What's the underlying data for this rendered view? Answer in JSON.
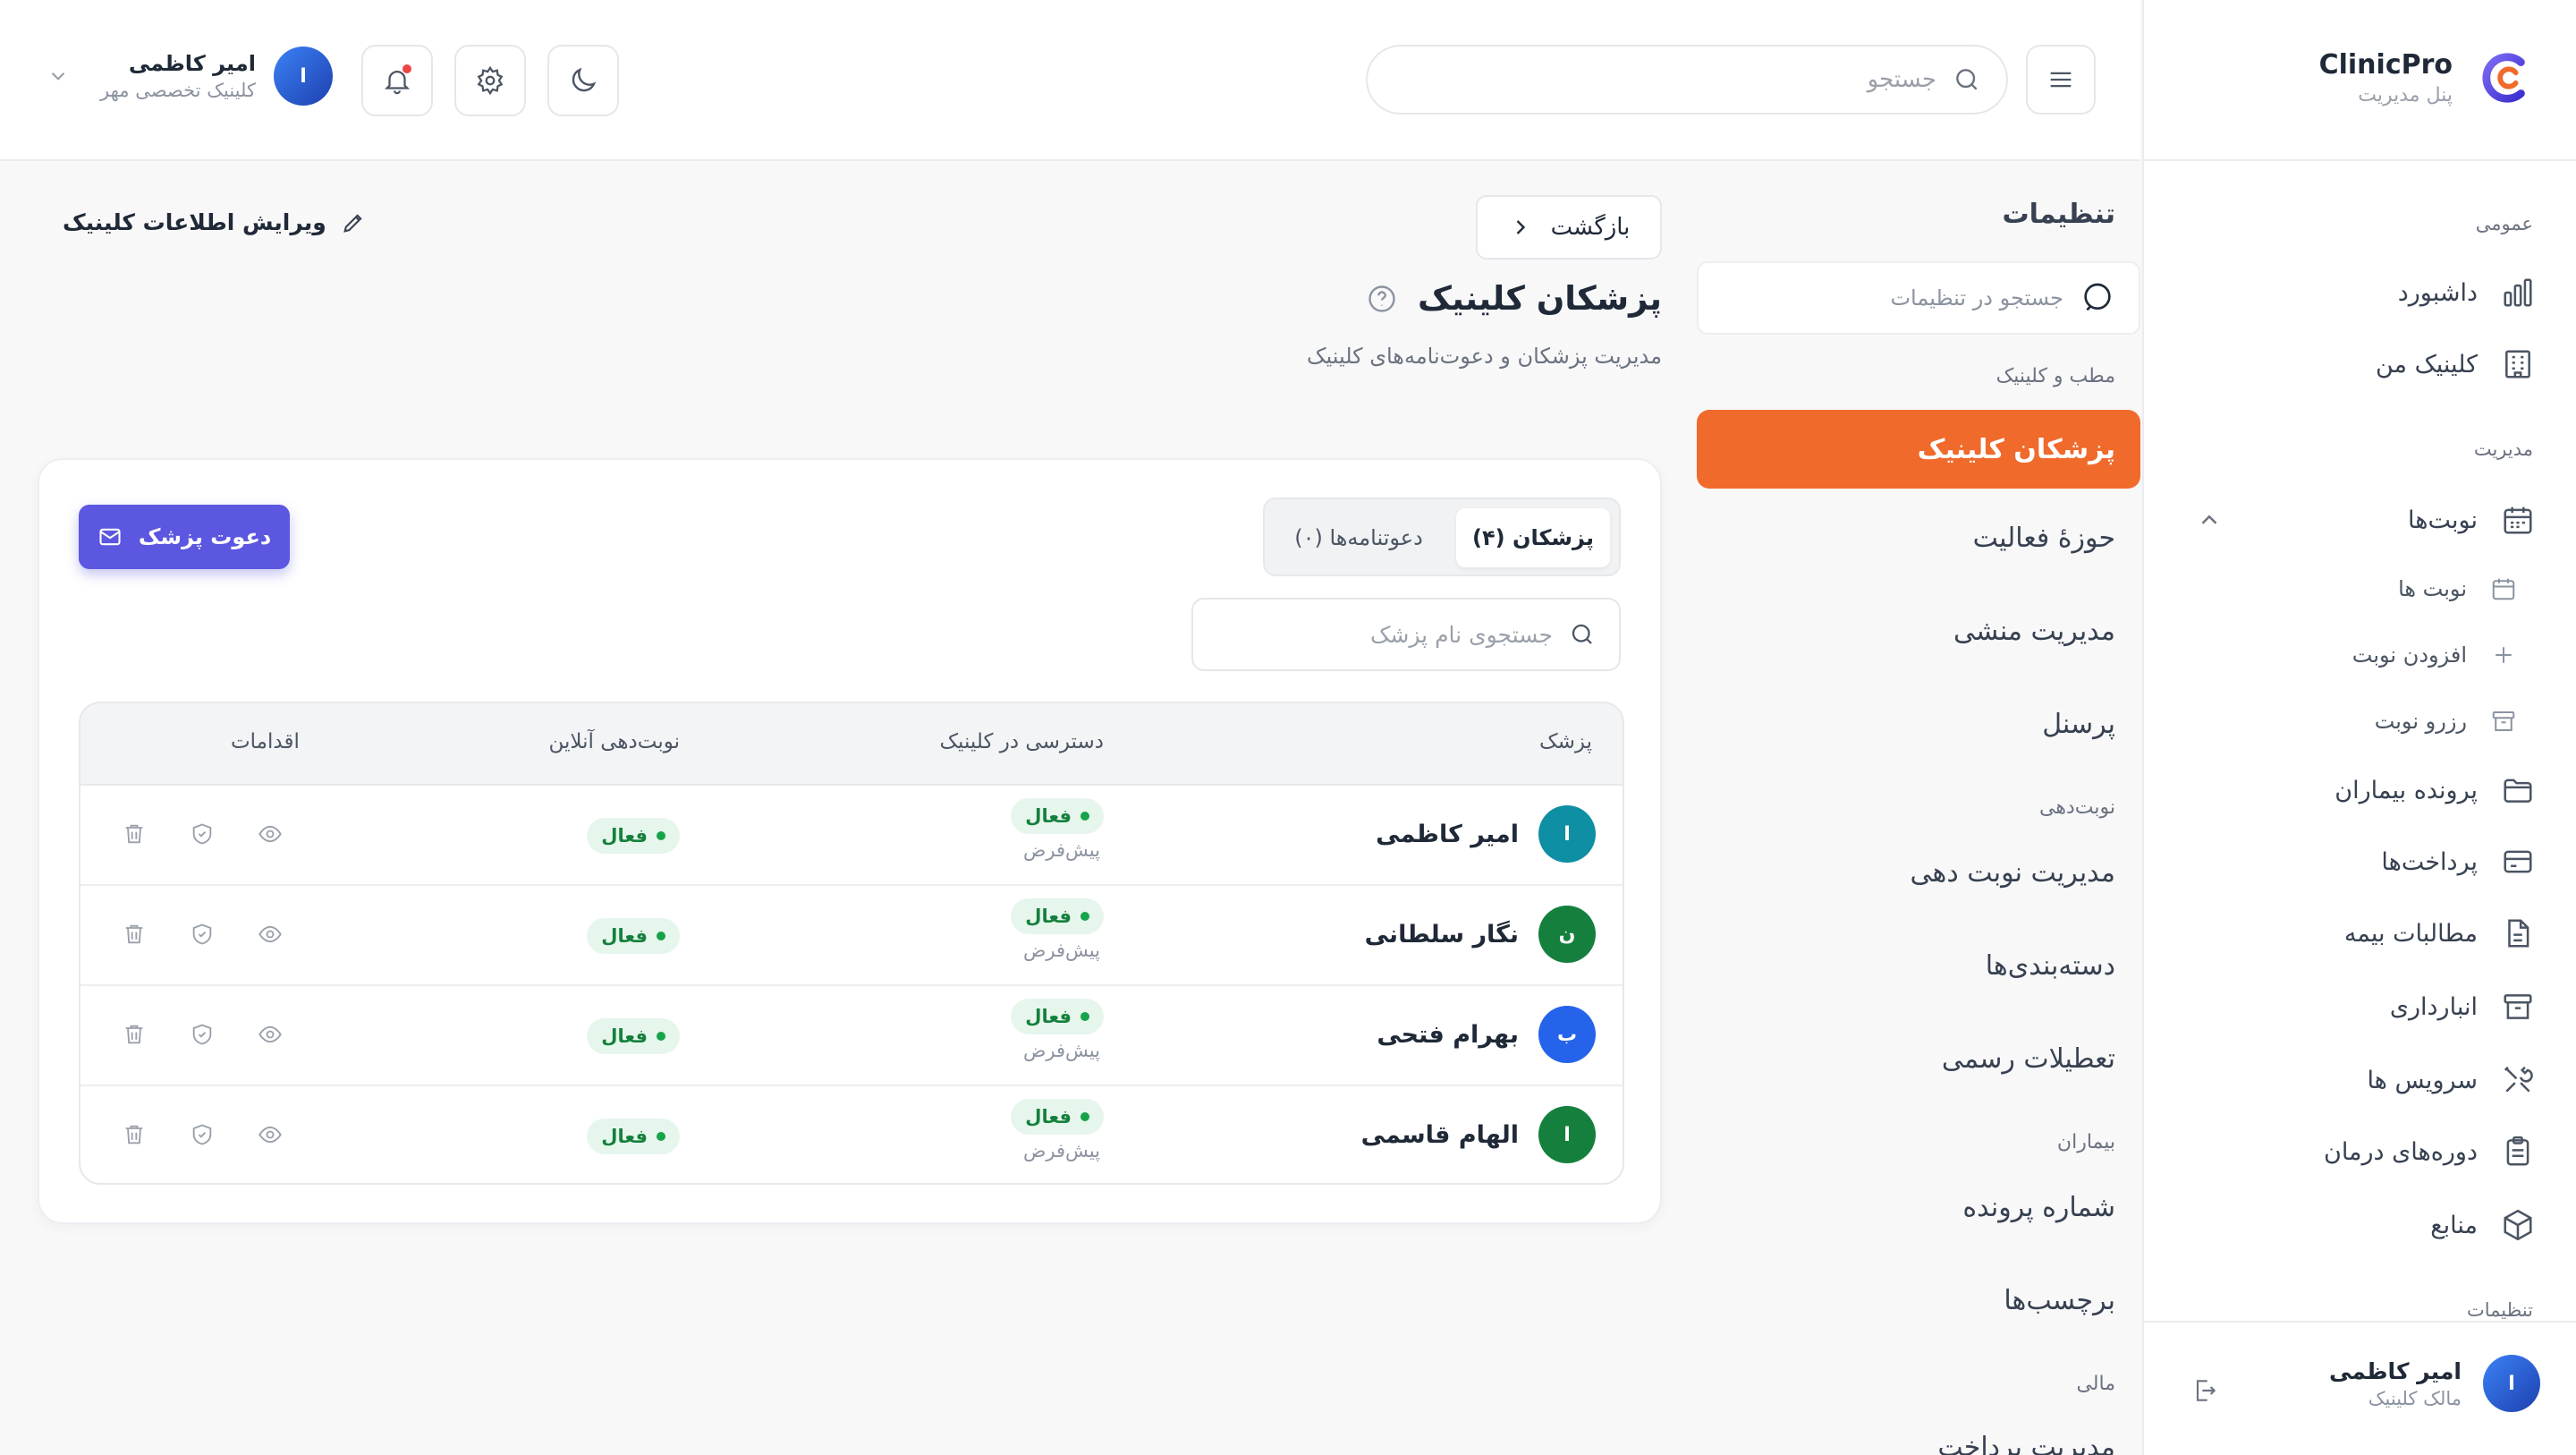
{
  "brand": {
    "title": "ClinicPro",
    "subtitle": "پنل مدیریت"
  },
  "sidebar": {
    "sections": {
      "general": "عمومی",
      "management": "مدیریت",
      "settings": "تنظیمات"
    },
    "items": {
      "dashboard": "داشبورد",
      "my_clinic": "کلینیک من",
      "appointments": "نوبت‌ها",
      "patient_files": "پرونده بیماران",
      "payments": "پرداخت‌ها",
      "insurance": "مطالبات بیمه",
      "warehouse": "انبارداری",
      "services": "سرویس ها",
      "courses": "دوره‌های درمان",
      "resources": "منابع"
    },
    "sub_items": {
      "appointments_list": "نوبت ها",
      "add_appointment": "افزودن نوبت",
      "reserve": "رزرو نوبت"
    },
    "user": {
      "name": "امیر کاظمی",
      "role": "مالک کلینیک",
      "initial": "ا"
    }
  },
  "topbar": {
    "search_placeholder": "جستجو",
    "user": {
      "name": "امیر کاظمی",
      "clinic": "کلینیک تخصصی مهر",
      "initial": "ا"
    }
  },
  "settings_nav": {
    "title": "تنظیمات",
    "search_placeholder": "جستجو در تنظیمات",
    "sections": {
      "office": "مطب و کلینیک",
      "booking": "نوبت‌دهی",
      "patients": "بیماران",
      "finance": "مالی"
    },
    "items": {
      "doctors": "پزشکان کلینیک",
      "activity": "حوزهٔ فعالیت",
      "secretary": "مدیریت منشی",
      "staff": "پرسنل",
      "booking_mgmt": "مدیریت نوبت دهی",
      "categories": "دسته‌بندی‌ها",
      "holidays": "تعطیلات رسمی",
      "file_number": "شماره پرونده",
      "tags": "برچسب‌ها",
      "payment_mgmt": "مدیریت پرداخت"
    }
  },
  "page": {
    "edit_link": "ویرایش اطلاعات کلینیک",
    "back": "بازگشت",
    "title": "پزشکان کلینیک",
    "subtitle": "مدیریت پزشکان و دعوت‌نامه‌های کلینیک",
    "invite_button": "دعوت پزشک",
    "tabs": {
      "doctors": "پزشکان (۴)",
      "invitations": "دعوتنامه‌ها (۰)"
    },
    "doctor_search_placeholder": "جستجوی نام پزشک"
  },
  "table": {
    "headers": {
      "doctor": "پزشک",
      "access": "دسترسی در کلینیک",
      "online": "نوبت‌دهی آنلاین",
      "actions": "اقدامات"
    },
    "rows": [
      {
        "name": "امیر کاظمی",
        "initial": "ا",
        "color": "#0e8fa3",
        "access_status": "فعال",
        "access_role": "پیش‌فرض",
        "online_status": "فعال"
      },
      {
        "name": "نگار سلطانی",
        "initial": "ن",
        "color": "#15803d",
        "access_status": "فعال",
        "access_role": "پیش‌فرض",
        "online_status": "فعال"
      },
      {
        "name": "بهرام فتحی",
        "initial": "ب",
        "color": "#2563eb",
        "access_status": "فعال",
        "access_role": "پیش‌فرض",
        "online_status": "فعال"
      },
      {
        "name": "الهام قاسمی",
        "initial": "ا",
        "color": "#15803d",
        "access_status": "فعال",
        "access_role": "پیش‌فرض",
        "online_status": "فعال"
      }
    ]
  },
  "colors": {
    "accent": "#f06a2c",
    "primary": "#5b57e0",
    "success": "#16a34a"
  }
}
